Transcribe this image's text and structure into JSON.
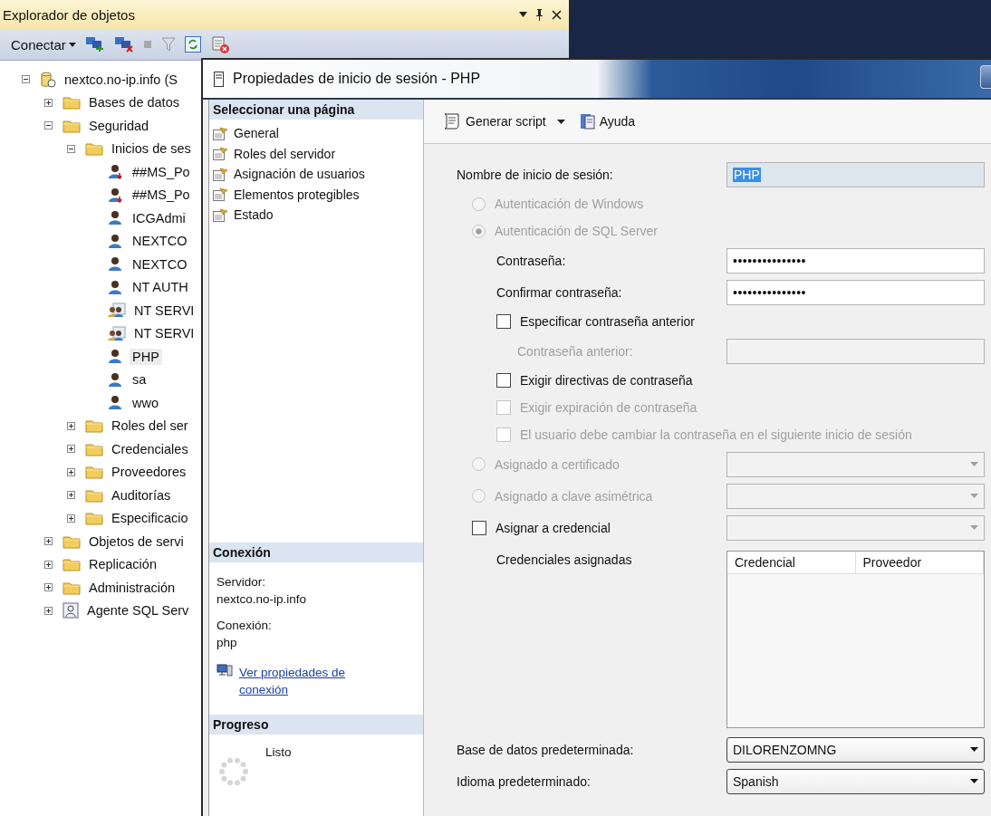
{
  "explorer": {
    "title": "Explorador de objetos",
    "connect": "Conectar",
    "tree": [
      {
        "label": "nextco.no-ip.info (S",
        "kind": "server",
        "expanded": true,
        "selected": false,
        "children": [
          {
            "label": "Bases de datos",
            "kind": "folder",
            "expanded": false,
            "selected": false
          },
          {
            "label": "Seguridad",
            "kind": "folder",
            "expanded": true,
            "selected": false,
            "children": [
              {
                "label": "Inicios de ses",
                "kind": "folder",
                "expanded": true,
                "selected": false,
                "children": [
                  {
                    "label": "##MS_Po",
                    "kind": "login-disabled",
                    "selected": false
                  },
                  {
                    "label": "##MS_Po",
                    "kind": "login-disabled",
                    "selected": false
                  },
                  {
                    "label": "ICGAdmi",
                    "kind": "login",
                    "selected": false
                  },
                  {
                    "label": "NEXTCO",
                    "kind": "login",
                    "selected": false
                  },
                  {
                    "label": "NEXTCO",
                    "kind": "login",
                    "selected": false
                  },
                  {
                    "label": "NT AUTH",
                    "kind": "login",
                    "selected": false
                  },
                  {
                    "label": "NT SERVI",
                    "kind": "group",
                    "selected": false
                  },
                  {
                    "label": "NT SERVI",
                    "kind": "group",
                    "selected": false
                  },
                  {
                    "label": "PHP",
                    "kind": "login",
                    "selected": true
                  },
                  {
                    "label": "sa",
                    "kind": "login",
                    "selected": false
                  },
                  {
                    "label": "wwo",
                    "kind": "login",
                    "selected": false
                  }
                ]
              },
              {
                "label": "Roles del ser",
                "kind": "folder",
                "expanded": false,
                "selected": false
              },
              {
                "label": "Credenciales",
                "kind": "folder",
                "expanded": false,
                "selected": false
              },
              {
                "label": "Proveedores",
                "kind": "folder",
                "expanded": false,
                "selected": false
              },
              {
                "label": "Auditorías",
                "kind": "folder",
                "expanded": false,
                "selected": false
              },
              {
                "label": "Especificacio",
                "kind": "folder",
                "expanded": false,
                "selected": false
              }
            ]
          },
          {
            "label": "Objetos de servi",
            "kind": "folder",
            "expanded": false,
            "selected": false
          },
          {
            "label": "Replicación",
            "kind": "folder",
            "expanded": false,
            "selected": false
          },
          {
            "label": "Administración",
            "kind": "folder",
            "expanded": false,
            "selected": false
          },
          {
            "label": "Agente SQL Serv",
            "kind": "agent",
            "expanded": false,
            "selected": false
          }
        ]
      }
    ]
  },
  "dialog": {
    "title": "Propiedades de inicio de sesión - PHP",
    "pages_header": "Seleccionar una página",
    "pages": [
      "General",
      "Roles del servidor",
      "Asignación de usuarios",
      "Elementos protegibles",
      "Estado"
    ],
    "connection": {
      "header": "Conexión",
      "server_label": "Servidor:",
      "server": "nextco.no-ip.info",
      "connection_label": "Conexión:",
      "connection": "php",
      "link": "Ver propiedades de conexión"
    },
    "progress": {
      "header": "Progreso",
      "status": "Listo"
    },
    "toolbar": [
      {
        "kind": "script",
        "label": "Generar script"
      },
      {
        "kind": "help",
        "label": "Ayuda"
      }
    ],
    "form": [
      {
        "kind": "label",
        "label": "Nombre de inicio de sesión:",
        "disabled": false,
        "control": {
          "kind": "text",
          "value": "PHP"
        }
      },
      {
        "kind": "radio",
        "label": "Autenticación de Windows",
        "selected": false,
        "disabled": true
      },
      {
        "kind": "radio",
        "label": "Autenticación de SQL Server",
        "selected": true,
        "disabled": true,
        "children": [
          {
            "kind": "label",
            "label": "Contraseña:",
            "disabled": false,
            "control": {
              "kind": "password",
              "value": "•••••••••••••••",
              "disabled": false
            }
          },
          {
            "kind": "label",
            "label": "Confirmar contraseña:",
            "disabled": false,
            "control": {
              "kind": "password",
              "value": "•••••••••••••••",
              "disabled": false
            }
          },
          {
            "kind": "checkbox",
            "label": "Especificar contraseña anterior",
            "checked": false,
            "disabled": false,
            "children": [
              {
                "kind": "label",
                "label": "Contraseña anterior:",
                "disabled": true,
                "control": {
                  "kind": "password",
                  "disabled": true
                }
              }
            ]
          },
          {
            "kind": "checkbox",
            "label": "Exigir directivas de contraseña",
            "checked": false,
            "disabled": false
          },
          {
            "kind": "checkbox",
            "label": "Exigir expiración de contraseña",
            "checked": false,
            "disabled": true
          },
          {
            "kind": "checkbox",
            "label": "El usuario debe cambiar la contraseña en el siguiente inicio de sesión",
            "checked": false,
            "disabled": true
          }
        ]
      },
      {
        "kind": "radio",
        "label": "Asignado a certificado",
        "selected": false,
        "disabled": true,
        "control": {
          "kind": "dropdown",
          "disabled": true
        }
      },
      {
        "kind": "radio",
        "label": "Asignado a clave asimétrica",
        "selected": false,
        "disabled": true,
        "control": {
          "kind": "dropdown",
          "disabled": true
        }
      },
      {
        "kind": "checkbox",
        "label": "Asignar a credencial",
        "checked": false,
        "disabled": false,
        "control": {
          "kind": "dropdown",
          "disabled": true
        },
        "children": [
          {
            "kind": "label",
            "label": "Credenciales asignadas",
            "disabled": false,
            "control": {
              "kind": "list",
              "columns": [
                "Credencial",
                "Proveedor"
              ]
            }
          }
        ]
      },
      {
        "kind": "label",
        "label": "Base de datos predeterminada:",
        "disabled": false,
        "control": {
          "kind": "dropdown",
          "value": "DILORENZOMNG",
          "disabled": false
        }
      },
      {
        "kind": "label",
        "label": "Idioma predeterminado:",
        "disabled": false,
        "control": {
          "kind": "dropdown",
          "value": "Spanish",
          "disabled": false
        }
      }
    ]
  }
}
